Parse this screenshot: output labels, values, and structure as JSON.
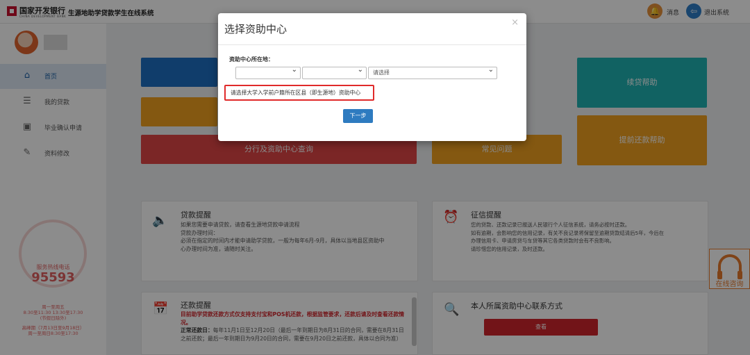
{
  "header": {
    "bank_name": "国家开发银行",
    "bank_name_en": "CHINA DEVELOPMENT BANK",
    "system_title": "生源地助学贷款学生在线系统",
    "messages_label": "消息",
    "logout_label": "退出系统"
  },
  "sidebar": {
    "items": [
      {
        "label": "首页",
        "icon": "home-icon"
      },
      {
        "label": "我的贷款",
        "icon": "document-icon"
      },
      {
        "label": "毕业确认申请",
        "icon": "inbox-icon"
      },
      {
        "label": "资料修改",
        "icon": "edit-icon"
      }
    ],
    "hotline": {
      "label": "服务热线电话",
      "number": "95593",
      "hours": [
        "周一至周五",
        "8:30至11:30 13:30至17:30",
        "(节假日除外)",
        "高峰期（7月13日至9月18日）",
        "周一至周日8:30至17:30"
      ]
    }
  },
  "tiles": {
    "branch_query": "分行及资助中心查询",
    "renewal_help": "续贷帮助",
    "early_repay_help": "提前还款帮助",
    "partial_center": "常见问题"
  },
  "cards": {
    "loan_notice": {
      "title": "贷款提醒",
      "lines": [
        "如果您需要申请贷款，请查看生源地贷款申请流程",
        "贷款办理时间：",
        "必须在指定的时间内才能申请助学贷款，一般为每年6月-9月，具体以当地县区资助中",
        "心办理时间为准，请随时关注。"
      ]
    },
    "credit_notice": {
      "title": "征信提醒",
      "lines": [
        "您的贷款、还款记录已报送人民银行个人征信系统，请务必按时还款。",
        "如有逾期，会影响您的信用记录，有关不良记录将保留至逾期贷款结清后5年，今后在",
        "办理信用卡、申请房贷与车贷等其它各类贷款时会有不良影响。",
        "请珍惜您的信用记录，及时还款。"
      ]
    },
    "repay_notice": {
      "title": "还款提醒",
      "red_text": "目前助学贷款还款方式仅支持支付宝和POS机还款，根据监管要求，还款后请及时查看还款情况。",
      "normal_label": "正常还款日：",
      "normal_text": "每年11月1日至12月20日（最后一年到期日为8月31日的合同，需要在8月31日之前还款；最后一年到期日为9月20日的合同，需要在9月20日之前还款，具体以合同为准）"
    },
    "contact": {
      "title": "本人所属资助中心联系方式",
      "view_button": "查看"
    }
  },
  "chat": {
    "label": "在线咨询"
  },
  "modal": {
    "title": "选择资助中心",
    "close": "×",
    "field_label": "资助中心所在地：",
    "select1": "",
    "select2": "",
    "select3": "请选择",
    "hint": "请选择大学入学前户籍所在区县（即生源地）资助中心",
    "next_button": "下一步"
  },
  "colors": {
    "blue": "#1e6fc4",
    "teal": "#1fb3b3",
    "orange": "#f0a020",
    "red": "#e04545",
    "accent": "#c8102e"
  }
}
